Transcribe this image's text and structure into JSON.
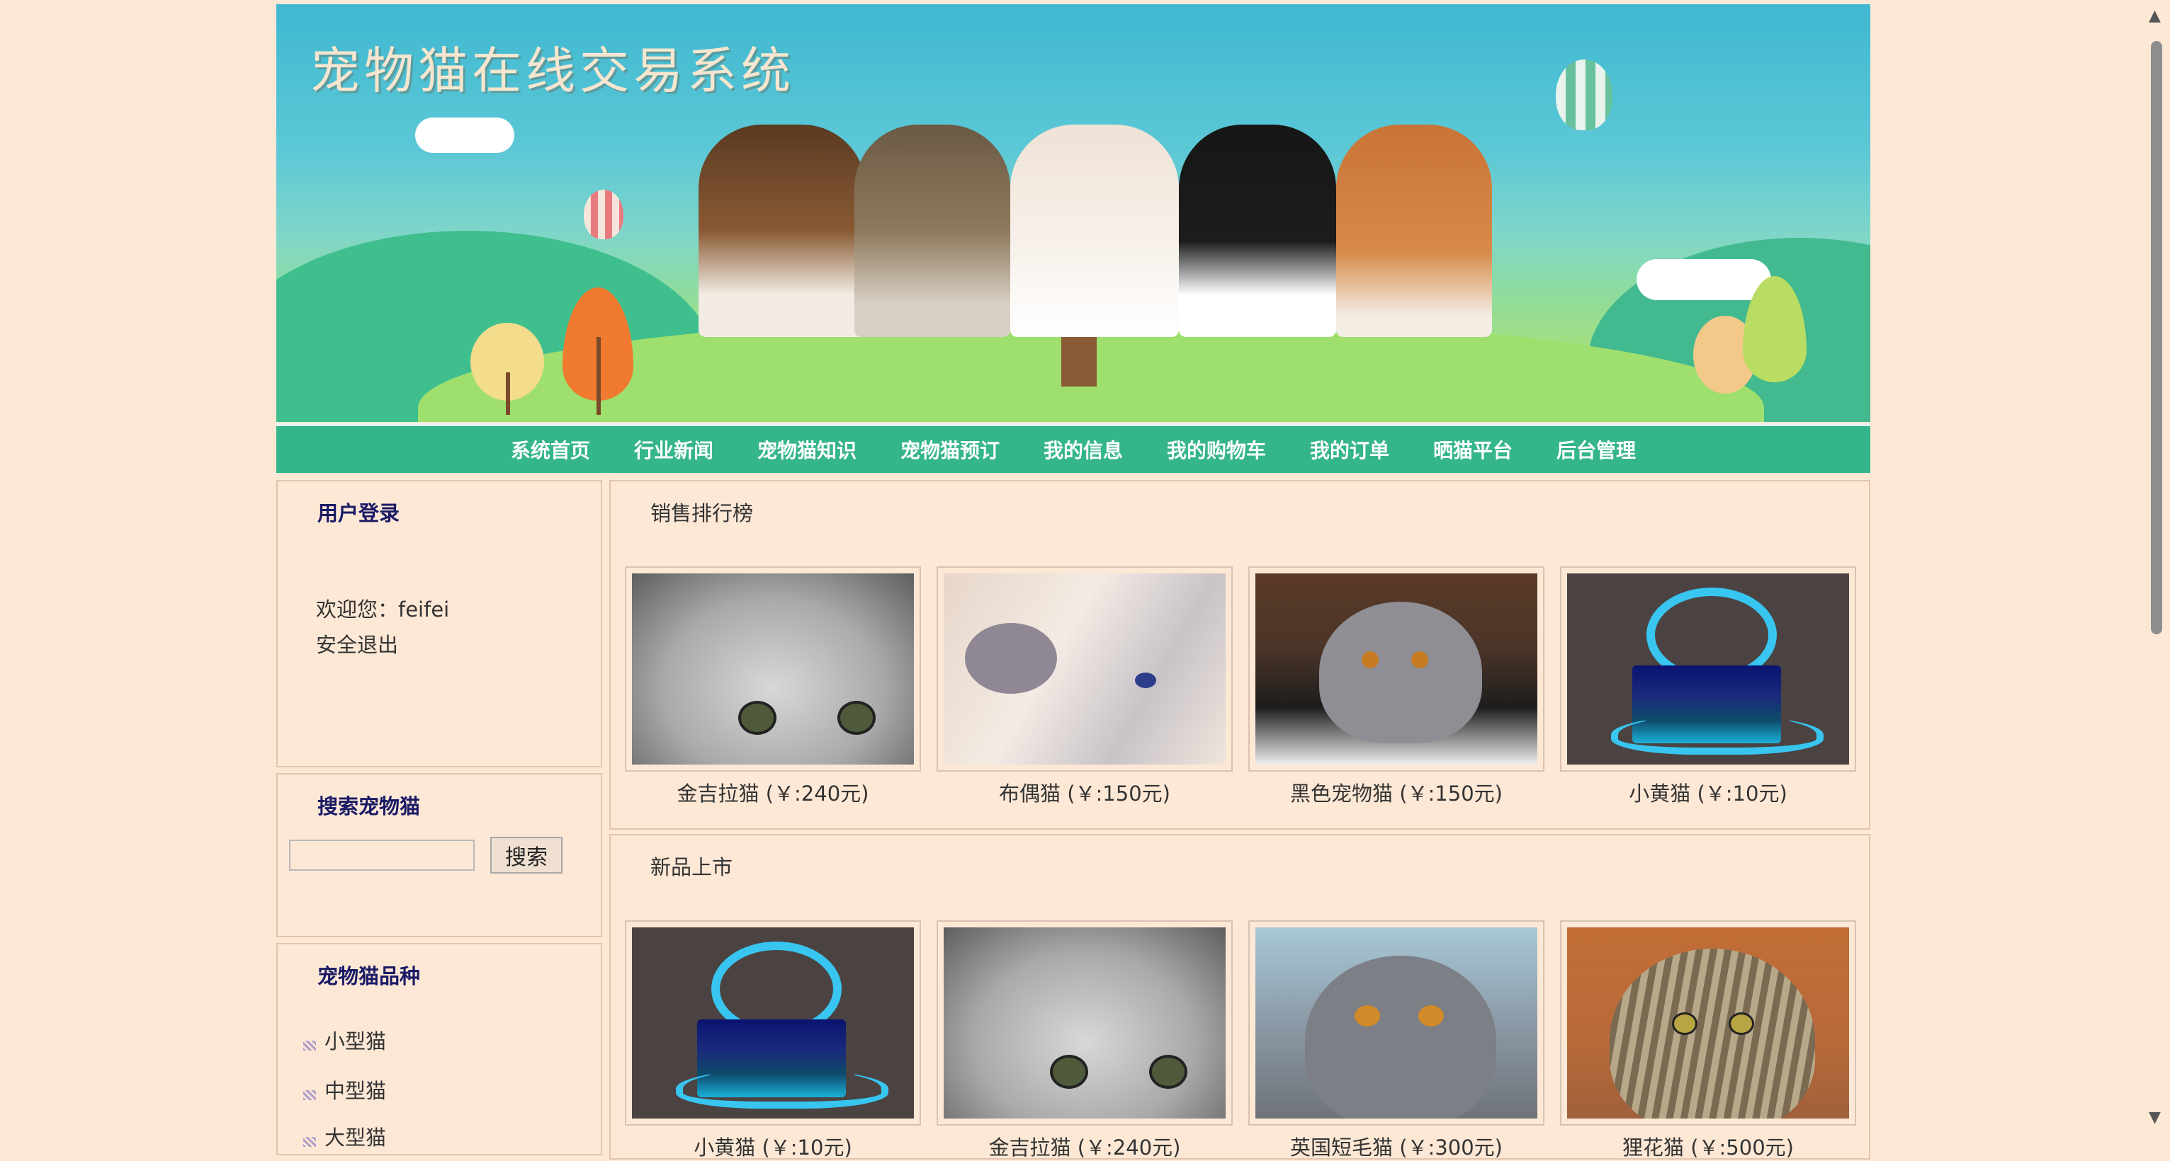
{
  "banner": {
    "title": "宠物猫在线交易系统"
  },
  "nav": {
    "items": [
      "系统首页",
      "行业新闻",
      "宠物猫知识",
      "宠物猫预订",
      "我的信息",
      "我的购物车",
      "我的订单",
      "晒猫平台",
      "后台管理"
    ]
  },
  "login": {
    "title": "用户登录",
    "welcome": "欢迎您：feifei",
    "logout": "安全退出"
  },
  "search": {
    "title": "搜索宠物猫",
    "button": "搜索",
    "value": ""
  },
  "breeds": {
    "title": "宠物猫品种",
    "items": [
      "小型猫",
      "中型猫",
      "大型猫"
    ]
  },
  "ranking": {
    "title": "销售排行榜",
    "products": [
      {
        "caption": "金吉拉猫 (￥:240元)",
        "image": "chinchilla-photo"
      },
      {
        "caption": "布偶猫 (￥:150元)",
        "image": "ragdoll-photo"
      },
      {
        "caption": "黑色宠物猫 (￥:150元)",
        "image": "grey-fold-photo"
      },
      {
        "caption": "小黄猫 (￥:10元)",
        "image": "placeholder-user-icon"
      }
    ]
  },
  "new_arrivals": {
    "title": "新品上市",
    "products": [
      {
        "caption": "小黄猫 (￥:10元)",
        "image": "placeholder-user-icon"
      },
      {
        "caption": "金吉拉猫 (￥:240元)",
        "image": "chinchilla-photo"
      },
      {
        "caption": "英国短毛猫 (￥:300元)",
        "image": "british-shorthair-photo"
      },
      {
        "caption": "狸花猫 (￥:500元)",
        "image": "tabby-photo"
      }
    ]
  },
  "colors": {
    "page_bg": "#fde8d6",
    "nav_bg": "#35b58c",
    "heading": "#1a1a66"
  }
}
